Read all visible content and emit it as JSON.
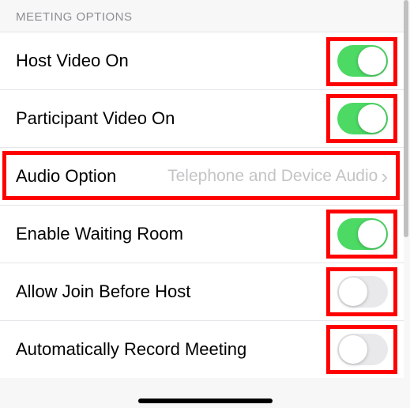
{
  "section_title": "MEETING OPTIONS",
  "rows": {
    "host_video": {
      "label": "Host Video On",
      "on": true
    },
    "participant_video": {
      "label": "Participant Video On",
      "on": true
    },
    "audio_option": {
      "label": "Audio Option",
      "value": "Telephone and Device Audio"
    },
    "waiting_room": {
      "label": "Enable Waiting Room",
      "on": true
    },
    "join_before": {
      "label": "Allow Join Before Host",
      "on": false
    },
    "auto_record": {
      "label": "Automatically Record Meeting",
      "on": false
    }
  }
}
